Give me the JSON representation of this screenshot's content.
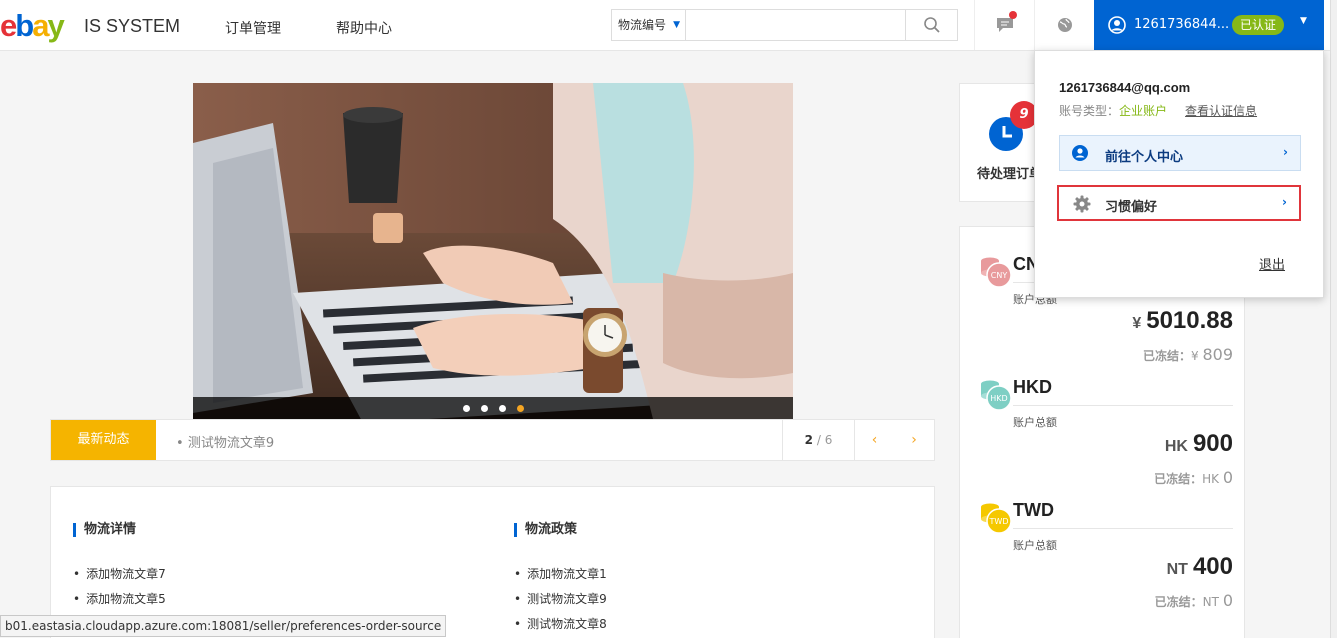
{
  "header": {
    "logo": [
      "e",
      "b",
      "a",
      "y"
    ],
    "system_name": "IS SYSTEM",
    "nav": [
      "订单管理",
      "帮助中心"
    ],
    "search": {
      "type_label": "物流编号",
      "value": "",
      "placeholder": ""
    },
    "user": {
      "name": "1261736844...",
      "verified_badge": "已认证"
    }
  },
  "banner": {
    "dots_total": 4,
    "active_dot": 4
  },
  "news": {
    "label": "最新动态",
    "item": "测试物流文章9",
    "page_current": "2",
    "page_sep_total": " / 6",
    "prev": "‹",
    "next": "›"
  },
  "sections": [
    {
      "title": "物流详情",
      "items": [
        "添加物流文章7",
        "添加物流文章5"
      ]
    },
    {
      "title": "物流政策",
      "items": [
        "添加物流文章1",
        "测试物流文章9",
        "测试物流文章8"
      ]
    }
  ],
  "pending": {
    "label": "待处理订单",
    "count": "9"
  },
  "accounts": {
    "total_label": "账户总额",
    "frozen_label": "已冻结：",
    "currencies": [
      {
        "code": "CNY",
        "coin_label": "CNY",
        "symbol": "¥",
        "amount": "5010.88",
        "frozen_symbol": "¥",
        "frozen": "809",
        "color": "#e89a9c"
      },
      {
        "code": "HKD",
        "coin_label": "HKD",
        "symbol": "HK",
        "amount": "900",
        "frozen_symbol": "HK",
        "frozen": "0",
        "color": "#7ecfc4"
      },
      {
        "code": "TWD",
        "coin_label": "TWD",
        "symbol": "NT",
        "amount": "400",
        "frozen_symbol": "NT",
        "frozen": "0",
        "color": "#f5c800"
      }
    ]
  },
  "dropdown": {
    "email": "1261736844@qq.com",
    "type_label": "账号类型：",
    "type_value": "企业账户",
    "view_cert": "查看认证信息",
    "personal_center": "前往个人中心",
    "preferences": "习惯偏好",
    "logout": "退出"
  },
  "status_url": "b01.eastasia.cloudapp.azure.com:18081/seller/preferences-order-source",
  "colors": {
    "brand_blue": "#0064d2",
    "accent_orange": "#f5b400",
    "alert_red": "#e53238",
    "verified_green": "#86b817"
  }
}
